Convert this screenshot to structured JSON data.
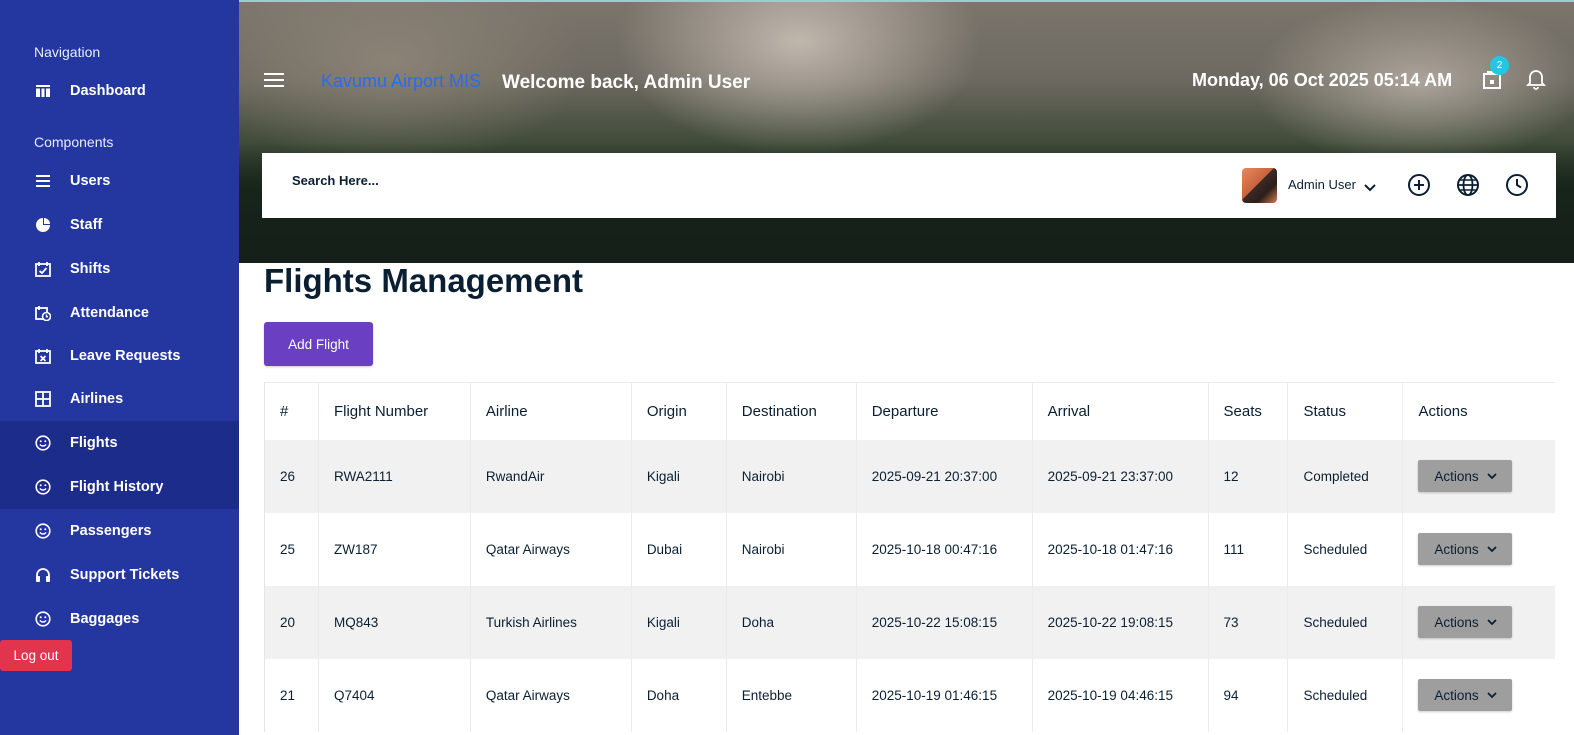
{
  "sidebar": {
    "section_navigation": "Navigation",
    "section_components": "Components",
    "items": [
      {
        "label": "Dashboard",
        "icon": "dashboard-icon"
      },
      {
        "label": "Users",
        "icon": "list-icon"
      },
      {
        "label": "Staff",
        "icon": "pie-icon"
      },
      {
        "label": "Shifts",
        "icon": "calendar-check-icon"
      },
      {
        "label": "Attendance",
        "icon": "calendar-clock-icon"
      },
      {
        "label": "Leave Requests",
        "icon": "calendar-x-icon"
      },
      {
        "label": "Airlines",
        "icon": "grid-icon"
      },
      {
        "label": "Flights",
        "icon": "smiley-icon"
      },
      {
        "label": "Flight History",
        "icon": "smiley-icon"
      },
      {
        "label": "Passengers",
        "icon": "smiley-icon"
      },
      {
        "label": "Support Tickets",
        "icon": "headset-icon"
      },
      {
        "label": "Baggages",
        "icon": "smiley-icon"
      }
    ],
    "logout_label": "Log out"
  },
  "header": {
    "brand": "Kavumu Airport MIS",
    "welcome": "Welcome back, Admin User",
    "datetime": "Monday, 06 Oct 2025 05:14 AM",
    "notification_count": "2"
  },
  "searchbar": {
    "placeholder": "Search Here...",
    "user_name": "Admin User"
  },
  "main": {
    "title": "Flights Management",
    "add_button": "Add Flight",
    "columns": [
      "#",
      "Flight Number",
      "Airline",
      "Origin",
      "Destination",
      "Departure",
      "Arrival",
      "Seats",
      "Status",
      "Actions"
    ],
    "rows": [
      {
        "id": "26",
        "flight": "RWA2111",
        "airline": "RwandAir",
        "origin": "Kigali",
        "destination": "Nairobi",
        "departure": "2025-09-21 20:37:00",
        "arrival": "2025-09-21 23:37:00",
        "seats": "12",
        "status": "Completed",
        "action": "Actions"
      },
      {
        "id": "25",
        "flight": "ZW187",
        "airline": "Qatar Airways",
        "origin": "Dubai",
        "destination": "Nairobi",
        "departure": "2025-10-18 00:47:16",
        "arrival": "2025-10-18 01:47:16",
        "seats": "111",
        "status": "Scheduled",
        "action": "Actions"
      },
      {
        "id": "20",
        "flight": "MQ843",
        "airline": "Turkish Airlines",
        "origin": "Kigali",
        "destination": "Doha",
        "departure": "2025-10-22 15:08:15",
        "arrival": "2025-10-22 19:08:15",
        "seats": "73",
        "status": "Scheduled",
        "action": "Actions"
      },
      {
        "id": "21",
        "flight": "Q7404",
        "airline": "Qatar Airways",
        "origin": "Doha",
        "destination": "Entebbe",
        "departure": "2025-10-19 01:46:15",
        "arrival": "2025-10-19 04:46:15",
        "seats": "94",
        "status": "Scheduled",
        "action": "Actions"
      }
    ]
  },
  "colors": {
    "sidebar": "#2436a0",
    "sidebar_active": "#1c2c8a",
    "brand": "#2a6cf0",
    "primary_button": "#6a3fc1",
    "logout": "#e3344d",
    "badge": "#22c7e6",
    "action_button": "#9e9e9e"
  }
}
